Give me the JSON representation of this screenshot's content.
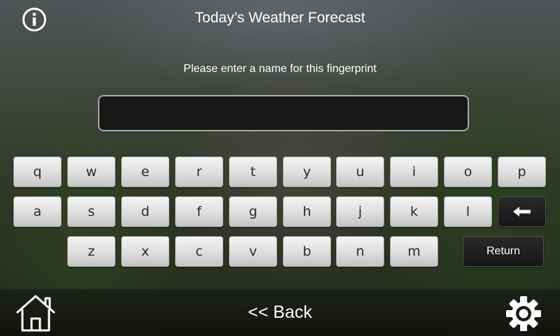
{
  "header": {
    "title": "Today’s Weather Forecast",
    "info_icon": "info-icon"
  },
  "prompt": "Please enter a name for this fingerprint",
  "name_field": {
    "value": "",
    "placeholder": ""
  },
  "keyboard": {
    "row1": [
      "q",
      "w",
      "e",
      "r",
      "t",
      "y",
      "u",
      "i",
      "o",
      "p"
    ],
    "row2": [
      "a",
      "s",
      "d",
      "f",
      "g",
      "h",
      "j",
      "k",
      "l"
    ],
    "row3": [
      "z",
      "x",
      "c",
      "v",
      "b",
      "n",
      "m"
    ],
    "backspace_icon": "backspace-arrow-icon",
    "return_label": "Return"
  },
  "footer": {
    "home_icon": "home-icon",
    "back_label": "<< Back",
    "settings_icon": "gear-icon"
  },
  "colors": {
    "text": "#ffffff",
    "key_face": "#e2e2e2",
    "key_dark": "#1c1c1c",
    "input_bg": "#121212"
  }
}
